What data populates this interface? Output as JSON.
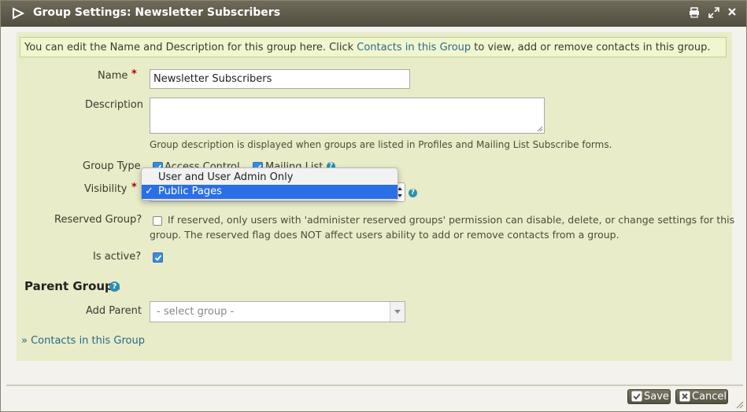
{
  "dialog": {
    "title": "Group Settings: Newsletter Subscribers",
    "buttons": {
      "print": "print",
      "maximize": "maximize",
      "close": "close"
    }
  },
  "help_banner": {
    "text_before": "You can edit the Name and Description for this group here. Click ",
    "link": "Contacts in this Group",
    "text_after": " to view, add or remove contacts in this group."
  },
  "form": {
    "name": {
      "label": "Name",
      "required": "*",
      "value": "Newsletter Subscribers"
    },
    "description": {
      "label": "Description",
      "value": "",
      "help": "Group description is displayed when groups are listed in Profiles and Mailing List Subscribe forms."
    },
    "group_type": {
      "label": "Group Type",
      "options": [
        {
          "label": "Access Control",
          "checked": true
        },
        {
          "label": "Mailing List",
          "checked": true
        }
      ]
    },
    "visibility": {
      "label": "Visibility",
      "required": "*",
      "dropdown_options": [
        {
          "label": "User and User Admin Only",
          "selected": false
        },
        {
          "label": "Public Pages",
          "selected": true,
          "check": "✓"
        }
      ]
    },
    "reserved": {
      "label": "Reserved Group?",
      "checked": false,
      "text_line1": "If reserved, only users with 'administer reserved groups' permission can disable, delete, or change settings for this",
      "text_line2": "group. The reserved flag does NOT affect users ability to add or remove contacts from a group."
    },
    "is_active": {
      "label": "Is active?",
      "checked": true
    }
  },
  "parent_groups": {
    "title": "Parent Groups",
    "add_parent_label": "Add Parent",
    "select_placeholder": "- select group -"
  },
  "contacts_link": "» Contacts in this Group",
  "footer": {
    "save_label": "Save",
    "cancel_label": "Cancel"
  },
  "colors": {
    "titlebar": "#5f5b4c",
    "panel": "#e8ecc8",
    "link": "#2a6a8a",
    "required": "#b30000",
    "selection": "#2a6fe6"
  }
}
